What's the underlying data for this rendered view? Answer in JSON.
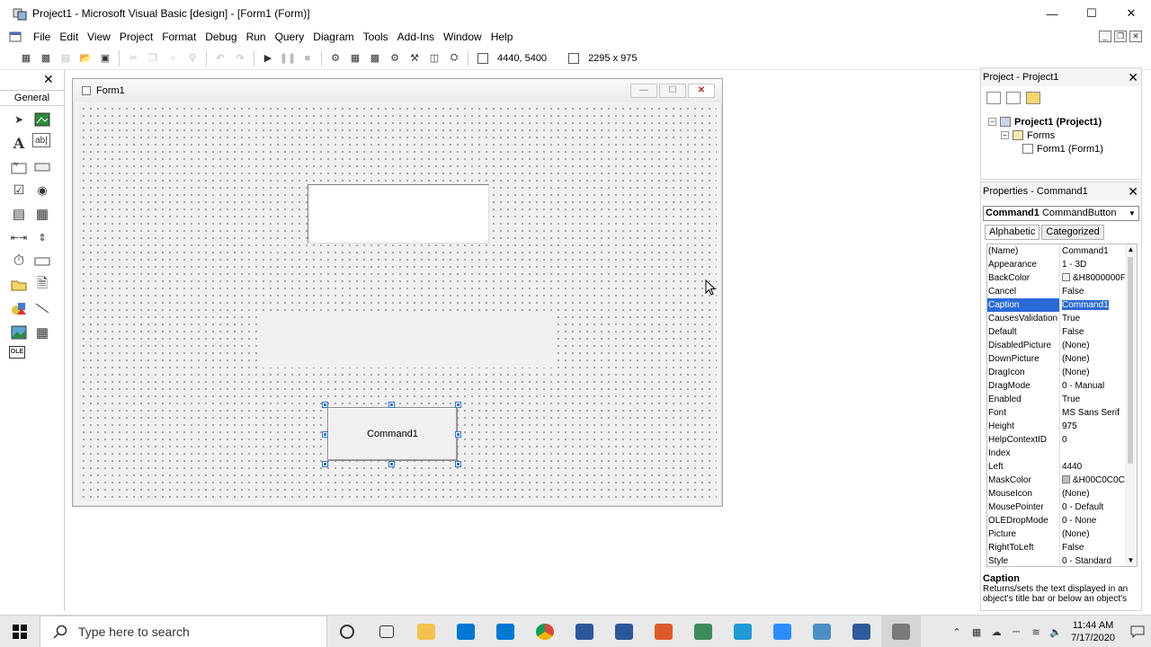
{
  "window": {
    "title": "Project1 - Microsoft Visual Basic [design] - [Form1 (Form)]",
    "controls": [
      "minimize-icon",
      "maximize-icon",
      "close-icon"
    ]
  },
  "menu": [
    "File",
    "Edit",
    "View",
    "Project",
    "Format",
    "Debug",
    "Run",
    "Query",
    "Diagram",
    "Tools",
    "Add-Ins",
    "Window",
    "Help"
  ],
  "toolbar": {
    "position_readout": "4440, 5400",
    "size_readout": "2295 x 975"
  },
  "toolbox": {
    "title": "General",
    "tools": [
      "pointer-icon",
      "picturebox-icon",
      "label-icon",
      "textbox-icon",
      "frame-icon",
      "commandbutton-icon",
      "checkbox-icon",
      "optionbutton-icon",
      "combobox-icon",
      "listbox-icon",
      "hscrollbar-icon",
      "vscrollbar-icon",
      "timer-icon",
      "drivelistbox-icon",
      "dirlistbox-icon",
      "filelistbox-icon",
      "shape-icon",
      "line-icon",
      "image-icon",
      "data-icon",
      "ole-icon"
    ]
  },
  "form": {
    "title": "Form1",
    "button_caption": "Command1"
  },
  "project": {
    "title": "Project - Project1",
    "tree": [
      {
        "label": "Project1 (Project1)",
        "level": 0
      },
      {
        "label": "Forms",
        "level": 1
      },
      {
        "label": "Form1 (Form1)",
        "level": 2
      }
    ]
  },
  "properties": {
    "title": "Properties - Command1",
    "object_name": "Command1",
    "object_type": "CommandButton",
    "tabs": [
      "Alphabetic",
      "Categorized"
    ],
    "rows": [
      {
        "name": "(Name)",
        "value": "Command1"
      },
      {
        "name": "Appearance",
        "value": "1 - 3D"
      },
      {
        "name": "BackColor",
        "value": "&H8000000F",
        "swatch": "#f0f0f0"
      },
      {
        "name": "Cancel",
        "value": "False"
      },
      {
        "name": "Caption",
        "value": "Command1",
        "selected": true
      },
      {
        "name": "CausesValidation",
        "value": "True"
      },
      {
        "name": "Default",
        "value": "False"
      },
      {
        "name": "DisabledPicture",
        "value": "(None)"
      },
      {
        "name": "DownPicture",
        "value": "(None)"
      },
      {
        "name": "DragIcon",
        "value": "(None)"
      },
      {
        "name": "DragMode",
        "value": "0 - Manual"
      },
      {
        "name": "Enabled",
        "value": "True"
      },
      {
        "name": "Font",
        "value": "MS Sans Serif"
      },
      {
        "name": "Height",
        "value": "975"
      },
      {
        "name": "HelpContextID",
        "value": "0"
      },
      {
        "name": "Index",
        "value": ""
      },
      {
        "name": "Left",
        "value": "4440"
      },
      {
        "name": "MaskColor",
        "value": "&H00C0C0C0",
        "swatch": "#c0c0c0"
      },
      {
        "name": "MouseIcon",
        "value": "(None)"
      },
      {
        "name": "MousePointer",
        "value": "0 - Default"
      },
      {
        "name": "OLEDropMode",
        "value": "0 - None"
      },
      {
        "name": "Picture",
        "value": "(None)"
      },
      {
        "name": "RightToLeft",
        "value": "False"
      },
      {
        "name": "Style",
        "value": "0 - Standard"
      }
    ],
    "description": {
      "title": "Caption",
      "text": "Returns/sets the text displayed in an object's title bar or below an object's"
    }
  },
  "taskbar": {
    "search_placeholder": "Type here to search",
    "apps": [
      {
        "name": "cortana",
        "color": "#333333"
      },
      {
        "name": "task-view",
        "color": "#333333"
      },
      {
        "name": "file-explorer",
        "color": "#f2c14e"
      },
      {
        "name": "mail",
        "color": "#0078d4"
      },
      {
        "name": "store",
        "color": "#0078d4"
      },
      {
        "name": "chrome",
        "color": "#db4437"
      },
      {
        "name": "file",
        "color": "#2b579a"
      },
      {
        "name": "word",
        "color": "#2b579a"
      },
      {
        "name": "app-orange",
        "color": "#e05a2b"
      },
      {
        "name": "app-green",
        "color": "#3d8b5a"
      },
      {
        "name": "edge",
        "color": "#1f9bd6"
      },
      {
        "name": "zoom",
        "color": "#2d8cff"
      },
      {
        "name": "app-blue",
        "color": "#4a90c2"
      },
      {
        "name": "visual-basic",
        "color": "#2e5b9a"
      },
      {
        "name": "app-active",
        "color": "#7a7a7a"
      }
    ],
    "time": "11:44 AM",
    "date": "7/17/2020"
  },
  "colors": {
    "selection": "#2a6ad6",
    "handle": "#2e75d4",
    "close_red": "#c42b1c"
  }
}
